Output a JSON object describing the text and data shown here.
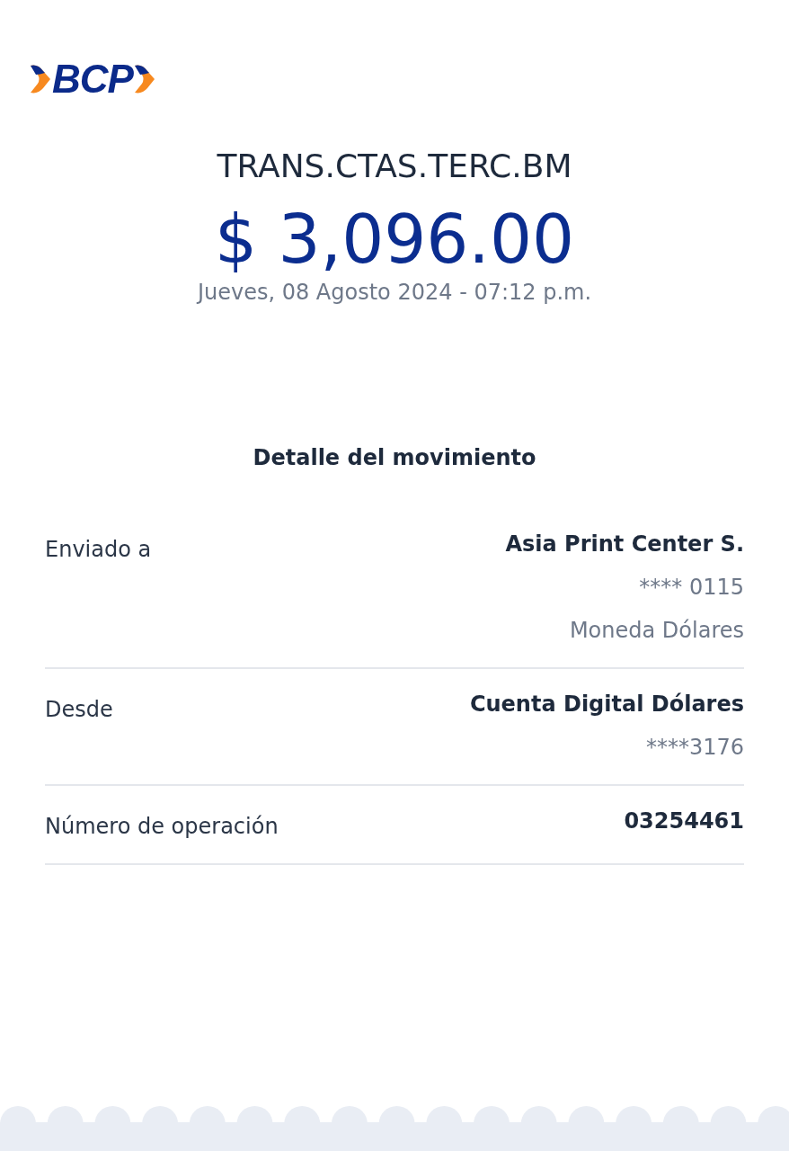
{
  "logo": {
    "text": "BCP"
  },
  "title": "TRANS.CTAS.TERC.BM",
  "amount": "$ 3,096.00",
  "date": "Jueves, 08 Agosto 2024 - 07:12 p.m.",
  "section_title": "Detalle del movimiento",
  "rows": [
    {
      "label": "Enviado a",
      "values": [
        {
          "text": "Asia Print Center S.",
          "kind": "primary"
        },
        {
          "text": "**** 0115",
          "kind": "secondary"
        },
        {
          "text": "Moneda Dólares",
          "kind": "secondary"
        }
      ]
    },
    {
      "label": "Desde",
      "values": [
        {
          "text": "Cuenta Digital Dólares",
          "kind": "primary"
        },
        {
          "text": "****3176",
          "kind": "secondary"
        }
      ]
    },
    {
      "label": "Número de operación",
      "values": [
        {
          "text": "03254461",
          "kind": "primary"
        }
      ]
    }
  ]
}
